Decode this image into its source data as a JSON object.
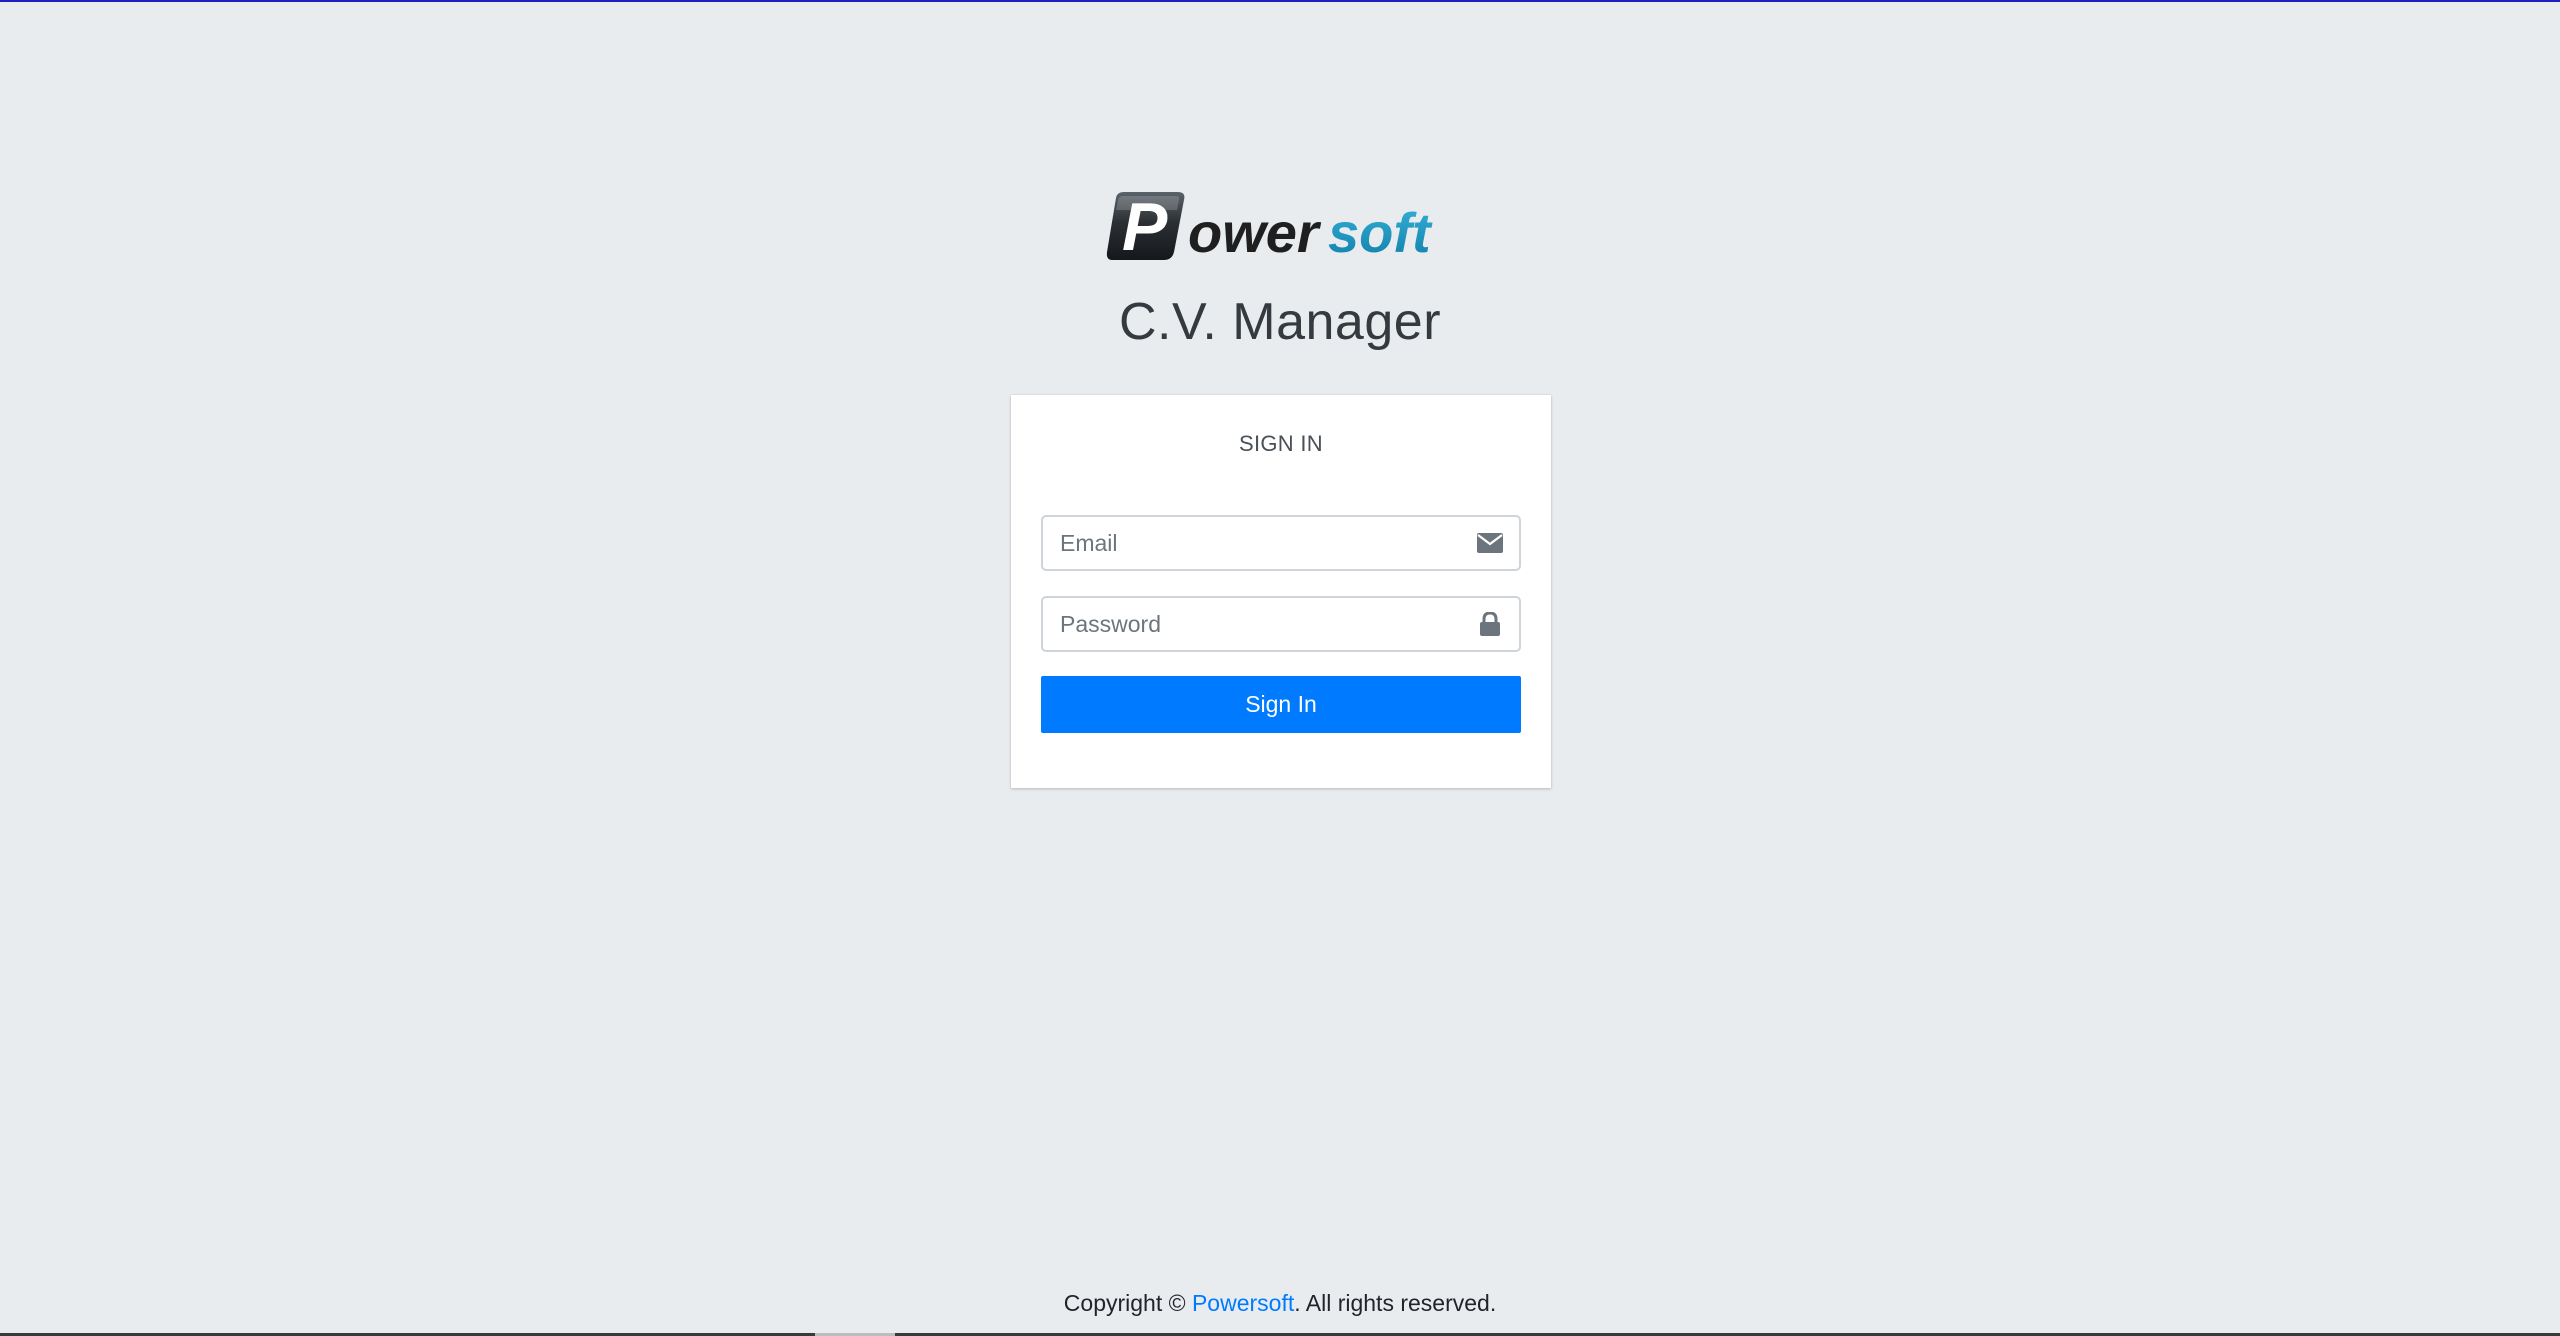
{
  "logo": {
    "text_p": "P",
    "text_ower": "ower",
    "text_soft": "soft",
    "colors": {
      "p_box": "#2b2f33",
      "ower": "#1f1f1f",
      "soft": "#1a8fb8"
    }
  },
  "app": {
    "title": "C.V. Manager"
  },
  "login_card": {
    "heading": "SIGN IN",
    "email": {
      "placeholder": "Email",
      "value": "",
      "icon": "envelope-icon"
    },
    "password": {
      "placeholder": "Password",
      "value": "",
      "icon": "lock-icon"
    },
    "submit_label": "Sign In"
  },
  "footer": {
    "prefix": "Copyright © ",
    "link_text": "Powersoft",
    "suffix": ". All rights reserved."
  },
  "colors": {
    "background": "#e9ecef",
    "primary": "#007bff",
    "card": "#ffffff"
  }
}
